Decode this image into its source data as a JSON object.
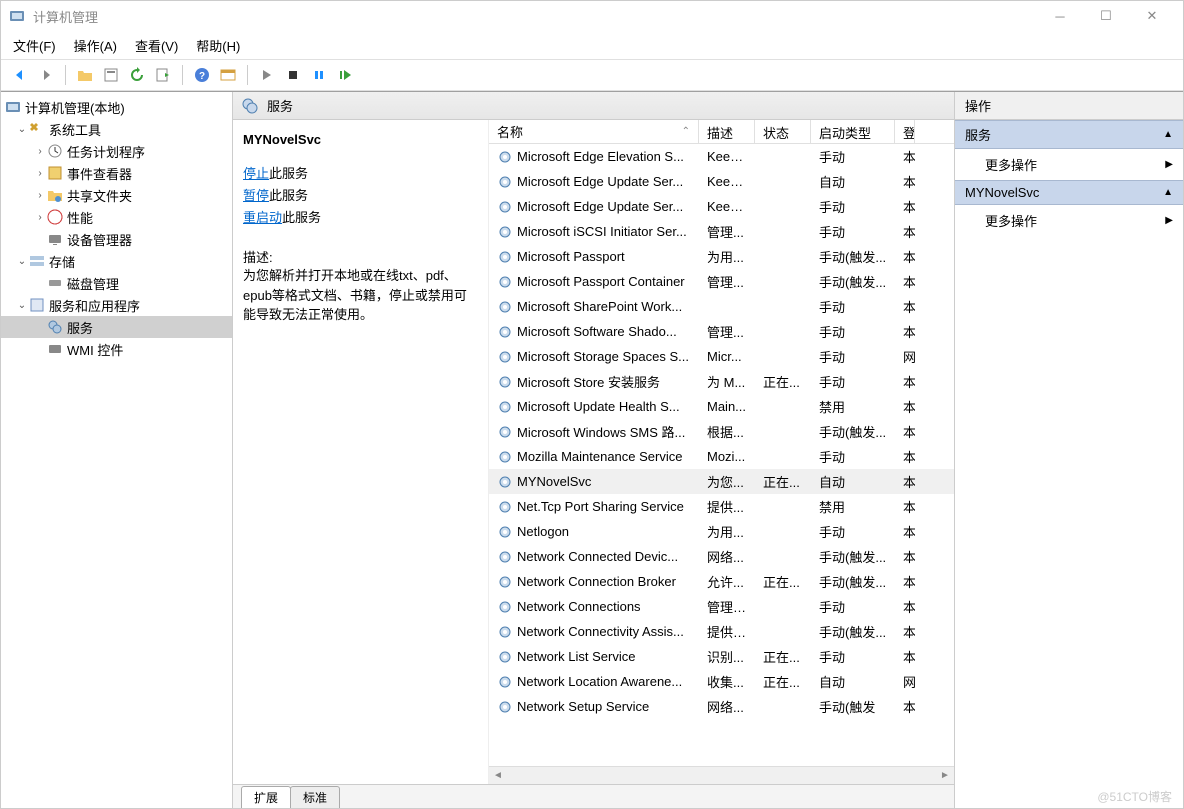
{
  "title": "计算机管理",
  "menubar": [
    "文件(F)",
    "操作(A)",
    "查看(V)",
    "帮助(H)"
  ],
  "tree": {
    "root": "计算机管理(本地)",
    "system_tools": "系统工具",
    "task_scheduler": "任务计划程序",
    "event_viewer": "事件查看器",
    "shared_folders": "共享文件夹",
    "performance": "性能",
    "device_manager": "设备管理器",
    "storage": "存储",
    "disk_management": "磁盘管理",
    "services_apps": "服务和应用程序",
    "services": "服务",
    "wmi": "WMI 控件"
  },
  "services_header": "服务",
  "detail": {
    "title": "MYNovelSvc",
    "stop_link": "停止",
    "pause_link": "暂停",
    "restart_link": "重启动",
    "suffix": "此服务",
    "desc_label": "描述:",
    "desc": "为您解析并打开本地或在线txt、pdf、epub等格式文档、书籍，停止或禁用可能导致无法正常使用。"
  },
  "columns": {
    "name": "名称",
    "desc": "描述",
    "status": "状态",
    "startup": "启动类型",
    "login": "登"
  },
  "rows": [
    {
      "name": "Microsoft Edge Elevation S...",
      "desc": "Keep...",
      "status": "",
      "startup": "手动",
      "login": "本"
    },
    {
      "name": "Microsoft Edge Update Ser...",
      "desc": "Keep...",
      "status": "",
      "startup": "自动",
      "login": "本"
    },
    {
      "name": "Microsoft Edge Update Ser...",
      "desc": "Keep...",
      "status": "",
      "startup": "手动",
      "login": "本"
    },
    {
      "name": "Microsoft iSCSI Initiator Ser...",
      "desc": "管理...",
      "status": "",
      "startup": "手动",
      "login": "本"
    },
    {
      "name": "Microsoft Passport",
      "desc": "为用...",
      "status": "",
      "startup": "手动(触发...",
      "login": "本"
    },
    {
      "name": "Microsoft Passport Container",
      "desc": "管理...",
      "status": "",
      "startup": "手动(触发...",
      "login": "本"
    },
    {
      "name": "Microsoft SharePoint Work...",
      "desc": "",
      "status": "",
      "startup": "手动",
      "login": "本"
    },
    {
      "name": "Microsoft Software Shado...",
      "desc": "管理...",
      "status": "",
      "startup": "手动",
      "login": "本"
    },
    {
      "name": "Microsoft Storage Spaces S...",
      "desc": "Micr...",
      "status": "",
      "startup": "手动",
      "login": "网"
    },
    {
      "name": "Microsoft Store 安装服务",
      "desc": "为 M...",
      "status": "正在...",
      "startup": "手动",
      "login": "本"
    },
    {
      "name": "Microsoft Update Health S...",
      "desc": "Main...",
      "status": "",
      "startup": "禁用",
      "login": "本"
    },
    {
      "name": "Microsoft Windows SMS 路...",
      "desc": "根据...",
      "status": "",
      "startup": "手动(触发...",
      "login": "本"
    },
    {
      "name": "Mozilla Maintenance Service",
      "desc": "Mozi...",
      "status": "",
      "startup": "手动",
      "login": "本"
    },
    {
      "name": "MYNovelSvc",
      "desc": "为您...",
      "status": "正在...",
      "startup": "自动",
      "login": "本",
      "selected": true
    },
    {
      "name": "Net.Tcp Port Sharing Service",
      "desc": "提供...",
      "status": "",
      "startup": "禁用",
      "login": "本"
    },
    {
      "name": "Netlogon",
      "desc": "为用...",
      "status": "",
      "startup": "手动",
      "login": "本"
    },
    {
      "name": "Network Connected Devic...",
      "desc": "网络...",
      "status": "",
      "startup": "手动(触发...",
      "login": "本"
    },
    {
      "name": "Network Connection Broker",
      "desc": "允许...",
      "status": "正在...",
      "startup": "手动(触发...",
      "login": "本"
    },
    {
      "name": "Network Connections",
      "desc": "管理\"...",
      "status": "",
      "startup": "手动",
      "login": "本"
    },
    {
      "name": "Network Connectivity Assis...",
      "desc": "提供 ...",
      "status": "",
      "startup": "手动(触发...",
      "login": "本"
    },
    {
      "name": "Network List Service",
      "desc": "识别...",
      "status": "正在...",
      "startup": "手动",
      "login": "本"
    },
    {
      "name": "Network Location Awarene...",
      "desc": "收集...",
      "status": "正在...",
      "startup": "自动",
      "login": "网"
    },
    {
      "name": "Network Setup Service",
      "desc": "网络...",
      "status": "",
      "startup": "手动(触发",
      "login": "本"
    }
  ],
  "tabs": {
    "extended": "扩展",
    "standard": "标准"
  },
  "actions": {
    "title": "操作",
    "services": "服务",
    "more": "更多操作",
    "selected": "MYNovelSvc"
  },
  "watermark": "@51CTO博客"
}
